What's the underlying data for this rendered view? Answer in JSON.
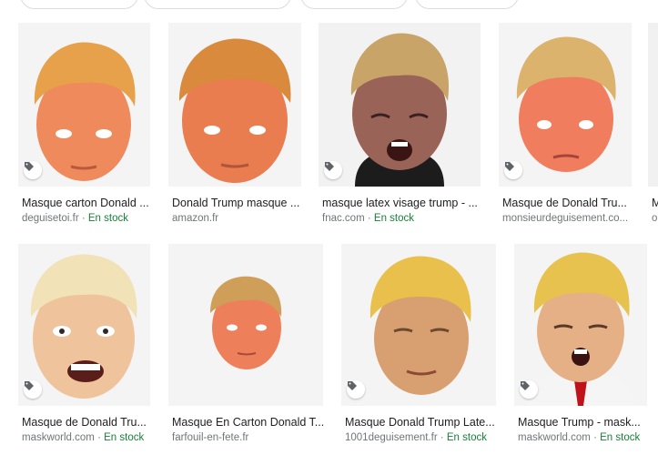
{
  "results": [
    {
      "title": "Masque carton Donald ...",
      "source": "deguisetoi.fr",
      "sep": " · ",
      "stock": "En stock"
    },
    {
      "title": "Donald Trump masque ...",
      "source": "amazon.fr",
      "sep": "",
      "stock": ""
    },
    {
      "title": "masque latex visage trump - ...",
      "source": "fnac.com",
      "sep": " · ",
      "stock": "En stock"
    },
    {
      "title": "Masque de Donald Tru...",
      "source": "monsieurdeguisement.co...",
      "sep": "",
      "stock": ""
    },
    {
      "title": "M",
      "source": "o",
      "sep": "",
      "stock": ""
    },
    {
      "title": "Masque de Donald Tru...",
      "source": "maskworld.com",
      "sep": " · ",
      "stock": "En stock"
    },
    {
      "title": "Masque En Carton Donald T...",
      "source": "farfouil-en-fete.fr",
      "sep": "",
      "stock": ""
    },
    {
      "title": "Masque Donald Trump Late...",
      "source": "1001deguisement.fr",
      "sep": " · ",
      "stock": "En stock"
    },
    {
      "title": "Masque Trump - mask...",
      "source": "maskworld.com",
      "sep": " · ",
      "stock": "En stock"
    }
  ],
  "colors": {
    "stock": "#188038",
    "source": "#70757a",
    "title": "#202124"
  },
  "icons": {
    "product_tag": "tag-icon"
  }
}
